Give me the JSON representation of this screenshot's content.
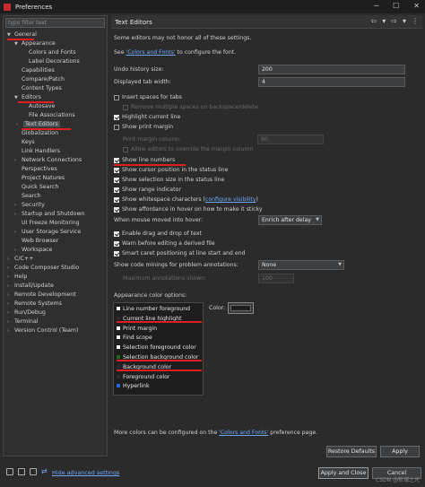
{
  "window": {
    "title": "Preferences"
  },
  "filter": {
    "placeholder": "type filter text"
  },
  "tree": [
    {
      "label": "General",
      "arrow": "▼"
    },
    {
      "label": "Appearance",
      "arrow": "▼"
    },
    {
      "label": "Colors and Fonts",
      "arrow": ""
    },
    {
      "label": "Label Decorations",
      "arrow": ""
    },
    {
      "label": "Capabilities",
      "arrow": ""
    },
    {
      "label": "Compare/Patch",
      "arrow": ""
    },
    {
      "label": "Content Types",
      "arrow": ""
    },
    {
      "label": "Editors",
      "arrow": "▼"
    },
    {
      "label": "Autosave",
      "arrow": ""
    },
    {
      "label": "File Associations",
      "arrow": ""
    },
    {
      "label": "Text Editors",
      "arrow": "›"
    },
    {
      "label": "Globalization",
      "arrow": ""
    },
    {
      "label": "Keys",
      "arrow": ""
    },
    {
      "label": "Link Handlers",
      "arrow": ""
    },
    {
      "label": "Network Connections",
      "arrow": "›"
    },
    {
      "label": "Perspectives",
      "arrow": ""
    },
    {
      "label": "Project Natures",
      "arrow": ""
    },
    {
      "label": "Quick Search",
      "arrow": ""
    },
    {
      "label": "Search",
      "arrow": ""
    },
    {
      "label": "Security",
      "arrow": "›"
    },
    {
      "label": "Startup and Shutdown",
      "arrow": "›"
    },
    {
      "label": "UI Freeze Monitoring",
      "arrow": ""
    },
    {
      "label": "User Storage Service",
      "arrow": "›"
    },
    {
      "label": "Web Browser",
      "arrow": ""
    },
    {
      "label": "Workspace",
      "arrow": "›"
    },
    {
      "label": "C/C++",
      "arrow": "›"
    },
    {
      "label": "Code Composer Studio",
      "arrow": "›"
    },
    {
      "label": "Help",
      "arrow": "›"
    },
    {
      "label": "Install/Update",
      "arrow": "›"
    },
    {
      "label": "Remote Development",
      "arrow": "›"
    },
    {
      "label": "Remote Systems",
      "arrow": "›"
    },
    {
      "label": "Run/Debug",
      "arrow": "›"
    },
    {
      "label": "Terminal",
      "arrow": "›"
    },
    {
      "label": "Version Control (Team)",
      "arrow": "›"
    }
  ],
  "page": {
    "title": "Text Editors",
    "intro": "Some editors may not honor all of these settings.",
    "see_prefix": "See ",
    "see_link": "'Colors and Fonts'",
    "see_suffix": " to configure the font.",
    "undo_label": "Undo history size:",
    "undo_value": "200",
    "tab_label": "Displayed tab width:",
    "tab_value": "4",
    "insert_spaces": "Insert spaces for tabs",
    "remove_spaces": "Remove multiple spaces on backspace/delete",
    "highlight_line": "Highlight current line",
    "show_print_margin": "Show print margin",
    "print_margin_col": "Print margin column:",
    "print_margin_value": "80",
    "allow_override": "Allow editors to override the margin column",
    "show_line_numbers": "Show line numbers",
    "show_cursor_pos": "Show cursor position in the status line",
    "show_sel_size": "Show selection size in the status line",
    "show_range": "Show range indicator",
    "show_ws_prefix": "Show whitespace characters (",
    "show_ws_link": "configure visibility",
    "show_ws_suffix": ")",
    "show_affordance": "Show affordance in hover on how to make it sticky",
    "hover_label": "When mouse moved into hover:",
    "hover_value": "Enrich after delay",
    "drag_drop": "Enable drag and drop of text",
    "warn_derived": "Warn before editing a derived file",
    "smart_caret": "Smart caret positioning at line start and end",
    "minings_label": "Show code minings for problem annotations:",
    "minings_value": "None",
    "max_annotations": "Maximum annotations shown:",
    "max_annotations_value": "100",
    "appearance_label": "Appearance color options:",
    "color_label": "Color:",
    "color_options": [
      "Line number foreground",
      "Current line highlight",
      "Print margin",
      "Find scope",
      "Selection foreground color",
      "Selection background color",
      "Background color",
      "Foreground color",
      "Hyperlink"
    ],
    "swatches": [
      "#ffffff",
      "#2b2b2b",
      "#ffffff",
      "#ffffff",
      "#ffffff",
      "#1b6b1b",
      "#2b2b2b",
      "#2b2b2b",
      "#1e6bd6"
    ],
    "more_prefix": "More colors can be configured on the ",
    "more_link": "'Colors and Fonts'",
    "more_suffix": " preference page.",
    "restore_defaults": "Restore Defaults",
    "apply": "Apply"
  },
  "footer": {
    "hide_advanced": "Hide advanced settings",
    "apply_close": "Apply and Close",
    "cancel": "Cancel",
    "watermark": "CSDN @新城之光"
  },
  "accent": "#e02020"
}
